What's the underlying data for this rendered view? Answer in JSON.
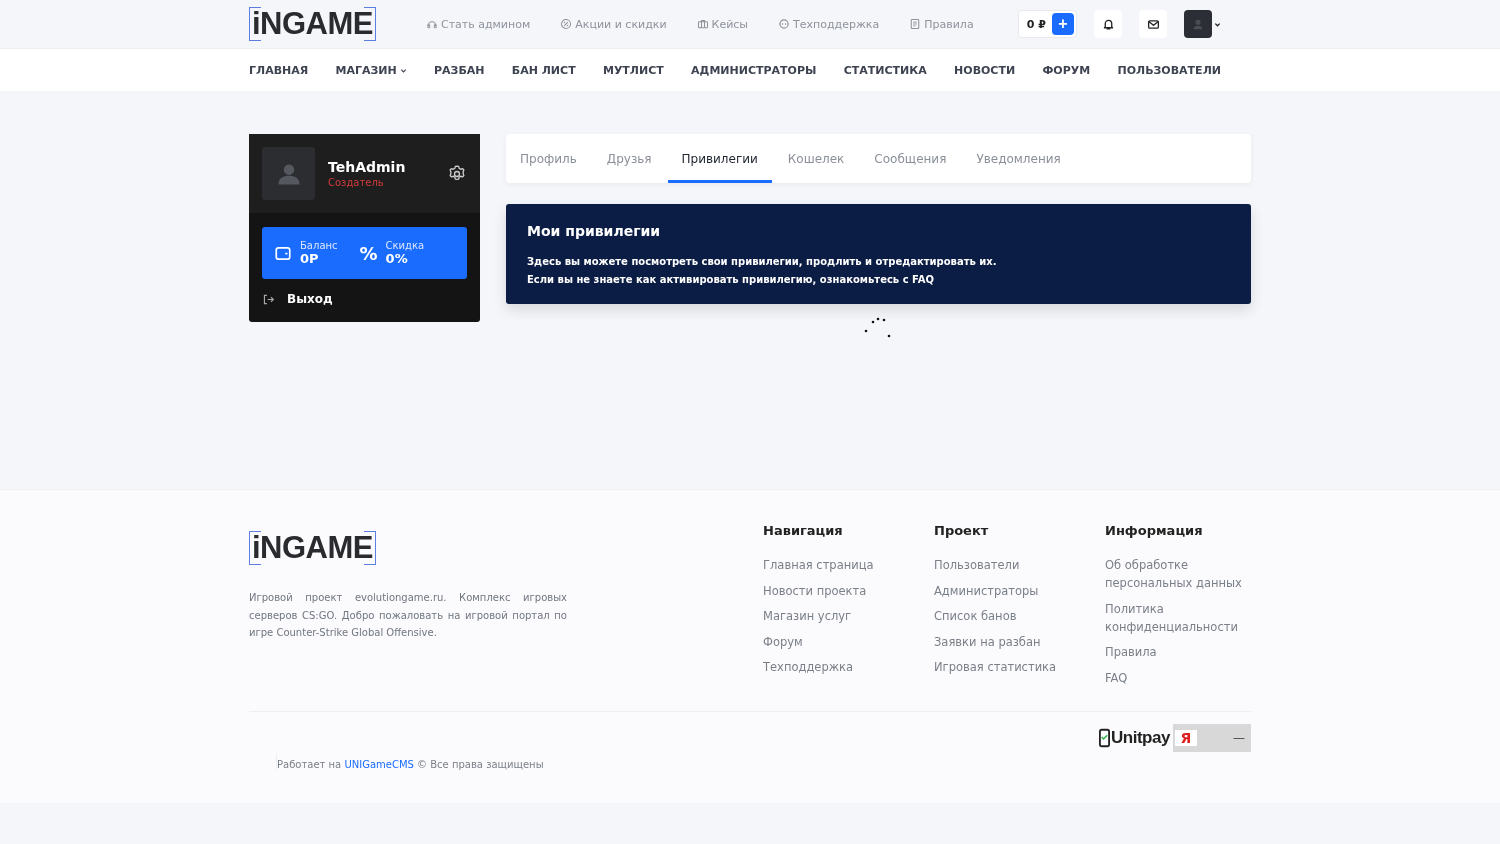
{
  "header": {
    "logo": "iNGAME",
    "links": [
      "Стать админом",
      "Акции и скидки",
      "Кейсы",
      "Техподдержка",
      "Правила"
    ],
    "balance": "0 ₽",
    "add_button": "+"
  },
  "nav": [
    {
      "label": "ГЛАВНАЯ",
      "dropdown": false
    },
    {
      "label": "МАГАЗИН",
      "dropdown": true
    },
    {
      "label": "РАЗБАН",
      "dropdown": false
    },
    {
      "label": "БАН ЛИСТ",
      "dropdown": false
    },
    {
      "label": "МУТЛИСТ",
      "dropdown": false
    },
    {
      "label": "АДМИНИСТРАТОРЫ",
      "dropdown": false
    },
    {
      "label": "СТАТИСТИКА",
      "dropdown": false
    },
    {
      "label": "НОВОСТИ",
      "dropdown": false
    },
    {
      "label": "ФОРУМ",
      "dropdown": false
    },
    {
      "label": "ПОЛЬЗОВАТЕЛИ",
      "dropdown": false
    }
  ],
  "profile": {
    "name": "TehAdmin",
    "role": "Создатель",
    "balance_label": "Баланс",
    "balance": "0Р",
    "discount_icon": "%",
    "discount_label": "Скидка",
    "discount": "0%",
    "logout": "Выход"
  },
  "tabs": [
    {
      "label": "Профиль",
      "selected": false
    },
    {
      "label": "Друзья",
      "selected": false
    },
    {
      "label": "Привилегии",
      "selected": true
    },
    {
      "label": "Кошелек",
      "selected": false
    },
    {
      "label": "Сообщения",
      "selected": false
    },
    {
      "label": "Уведомления",
      "selected": false
    }
  ],
  "notice": {
    "title": "Мои привилегии",
    "lines": [
      "Здесь вы можете посмотреть свои привилегии, продлить и отредактировать их.",
      "Если вы не знаете как активировать привилегию, ознакомьтесь с FAQ"
    ]
  },
  "footer": {
    "logo": "iNGAME",
    "description": "Игровой проект evolutiongame.ru. Комплекс игровых серверов CS:GO. Добро пожаловать на игровой портал по игре Counter-Strike Global Offensive.",
    "columns": [
      {
        "title": "Навигация",
        "links": [
          "Главная страница",
          "Новости проекта",
          "Магазин услуг",
          "Форум",
          "Техподдержка"
        ]
      },
      {
        "title": "Проект",
        "links": [
          "Пользователи",
          "Администраторы",
          "Список банов",
          "Заявки на разбан",
          "Игровая статистика"
        ]
      },
      {
        "title": "Информация",
        "links": [
          "Об обработке персональных данных",
          "Политика конфиденциальности",
          "Правила",
          "FAQ"
        ]
      }
    ],
    "powered_prefix": "Работает на",
    "powered_link": "UNIGameCMS",
    "powered_suffix": "© Все права защищены",
    "payment": {
      "name": "Unitpay",
      "badge": "Я",
      "dash": "—"
    }
  }
}
